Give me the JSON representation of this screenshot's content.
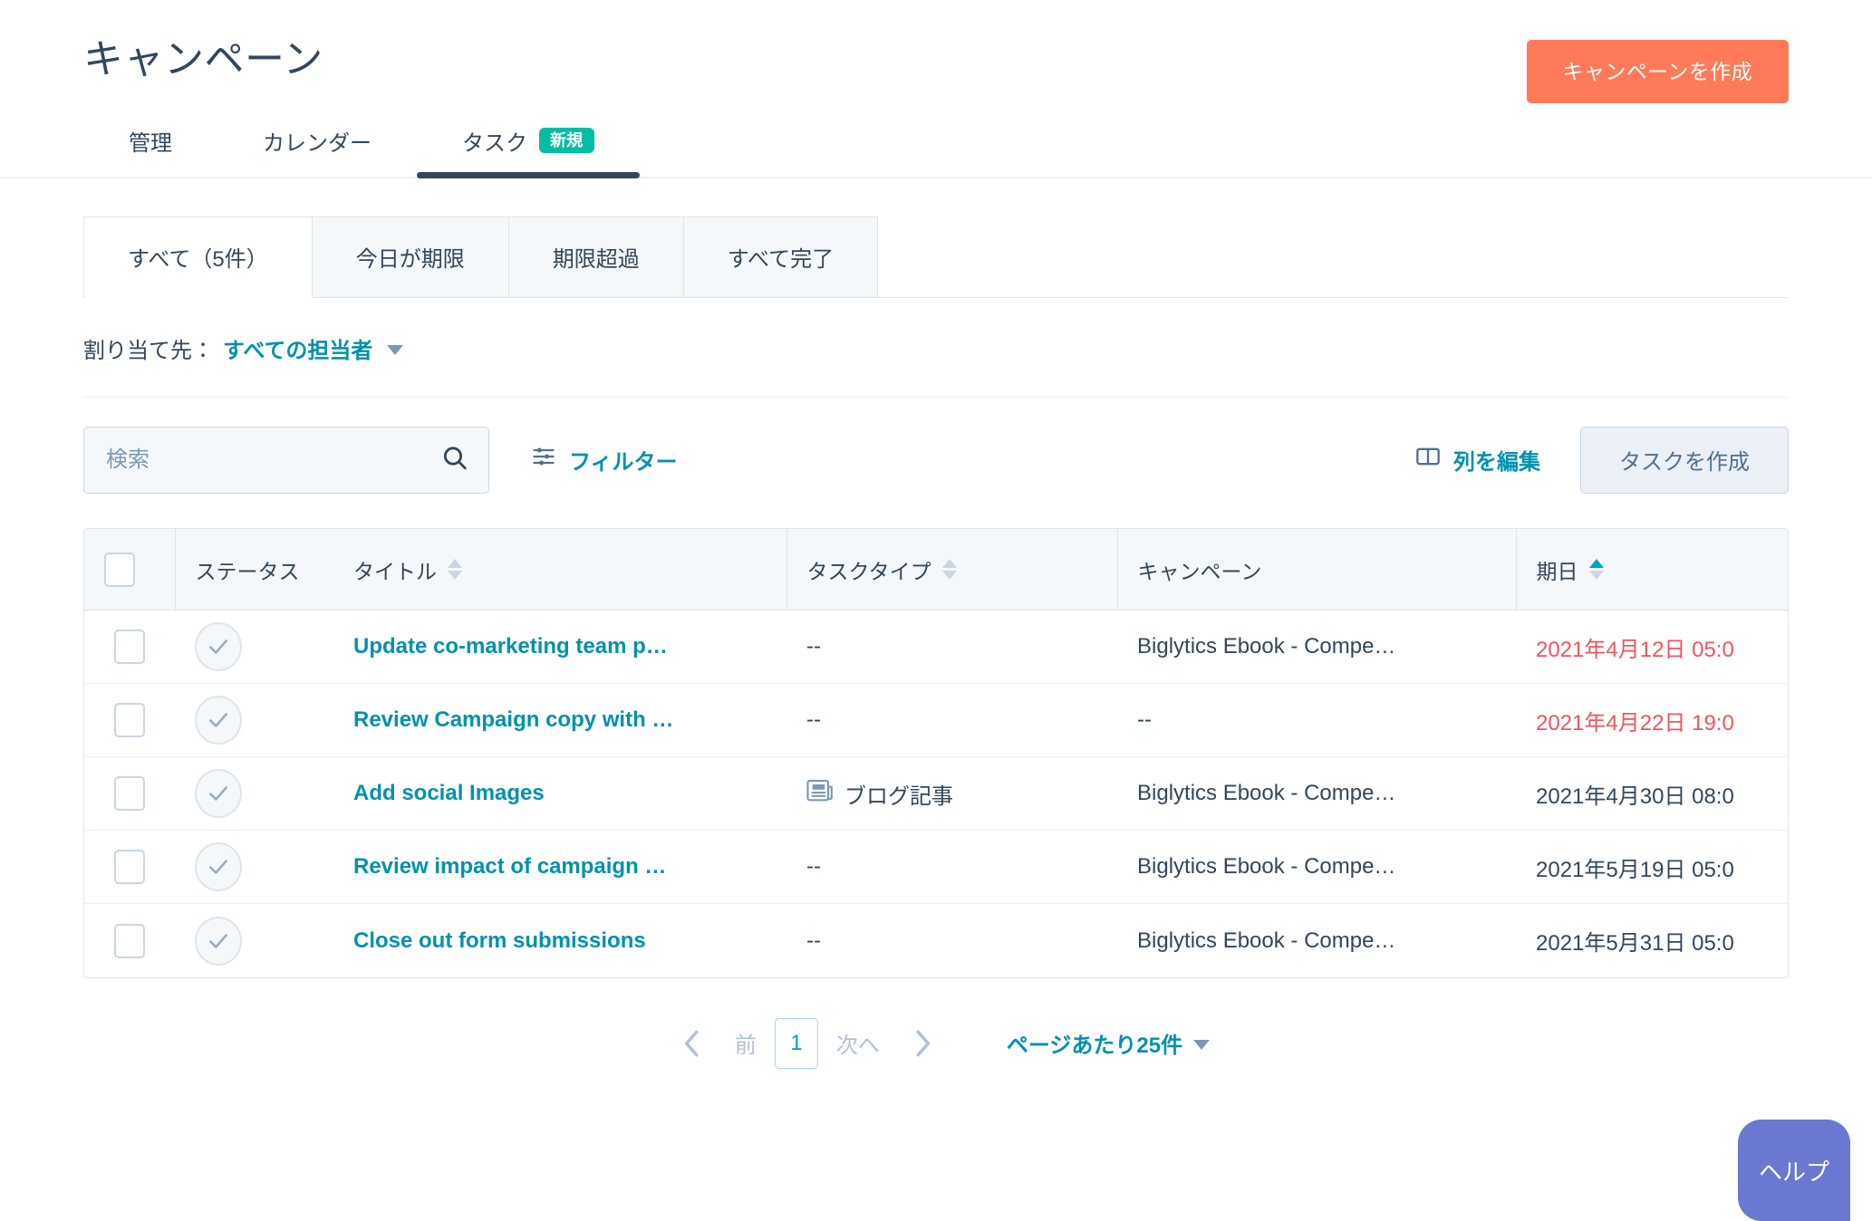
{
  "header": {
    "title": "キャンペーン",
    "create_button": "キャンペーンを作成"
  },
  "nav_tabs": [
    {
      "label": "管理",
      "active": false,
      "badge": ""
    },
    {
      "label": "カレンダー",
      "active": false,
      "badge": ""
    },
    {
      "label": "タスク",
      "active": true,
      "badge": "新規"
    }
  ],
  "filter_tabs": [
    {
      "label": "すべて（5件）",
      "active": true
    },
    {
      "label": "今日が期限",
      "active": false
    },
    {
      "label": "期限超過",
      "active": false
    },
    {
      "label": "すべて完了",
      "active": false
    }
  ],
  "assignee": {
    "label": "割り当て先：",
    "value": "すべての担当者"
  },
  "toolbar": {
    "search_placeholder": "検索",
    "search_value": "",
    "filter_label": "フィルター",
    "edit_columns_label": "列を編集",
    "create_task_label": "タスクを作成"
  },
  "table": {
    "columns": [
      {
        "key": "check",
        "label": "",
        "sortable": false
      },
      {
        "key": "status",
        "label": "ステータス",
        "sortable": false
      },
      {
        "key": "title",
        "label": "タイトル",
        "sortable": true,
        "sort": "none"
      },
      {
        "key": "type",
        "label": "タスクタイプ",
        "sortable": true,
        "sort": "none"
      },
      {
        "key": "campaign",
        "label": "キャンペーン",
        "sortable": false
      },
      {
        "key": "due",
        "label": "期日",
        "sortable": true,
        "sort": "asc"
      }
    ],
    "rows": [
      {
        "title": "Update co-marketing team p…",
        "type": "--",
        "type_icon": "",
        "campaign": "Biglytics Ebook - Compe…",
        "due": "2021年4月12日 05:0",
        "overdue": true
      },
      {
        "title": "Review Campaign copy with …",
        "type": "--",
        "type_icon": "",
        "campaign": "--",
        "due": "2021年4月22日 19:0",
        "overdue": true
      },
      {
        "title": "Add social Images",
        "type": "ブログ記事",
        "type_icon": "blog-post-icon",
        "campaign": "Biglytics Ebook - Compe…",
        "due": "2021年4月30日 08:0",
        "overdue": false
      },
      {
        "title": "Review impact of campaign …",
        "type": "--",
        "type_icon": "",
        "campaign": "Biglytics Ebook - Compe…",
        "due": "2021年5月19日 05:0",
        "overdue": false
      },
      {
        "title": "Close out form submissions",
        "type": "--",
        "type_icon": "",
        "campaign": "Biglytics Ebook - Compe…",
        "due": "2021年5月31日 05:0",
        "overdue": false
      }
    ]
  },
  "pagination": {
    "prev_label": "前",
    "current_page": "1",
    "next_label": "次へ",
    "per_page_label": "ページあたり25件"
  },
  "help": {
    "label": "ヘルプ"
  },
  "colors": {
    "brand_orange": "#ff7a59",
    "teal_link": "#0091ae",
    "badge_teal": "#00bda5",
    "overdue_red": "#f2545b",
    "help_purple": "#6a78d1",
    "text_navy": "#33475b"
  }
}
